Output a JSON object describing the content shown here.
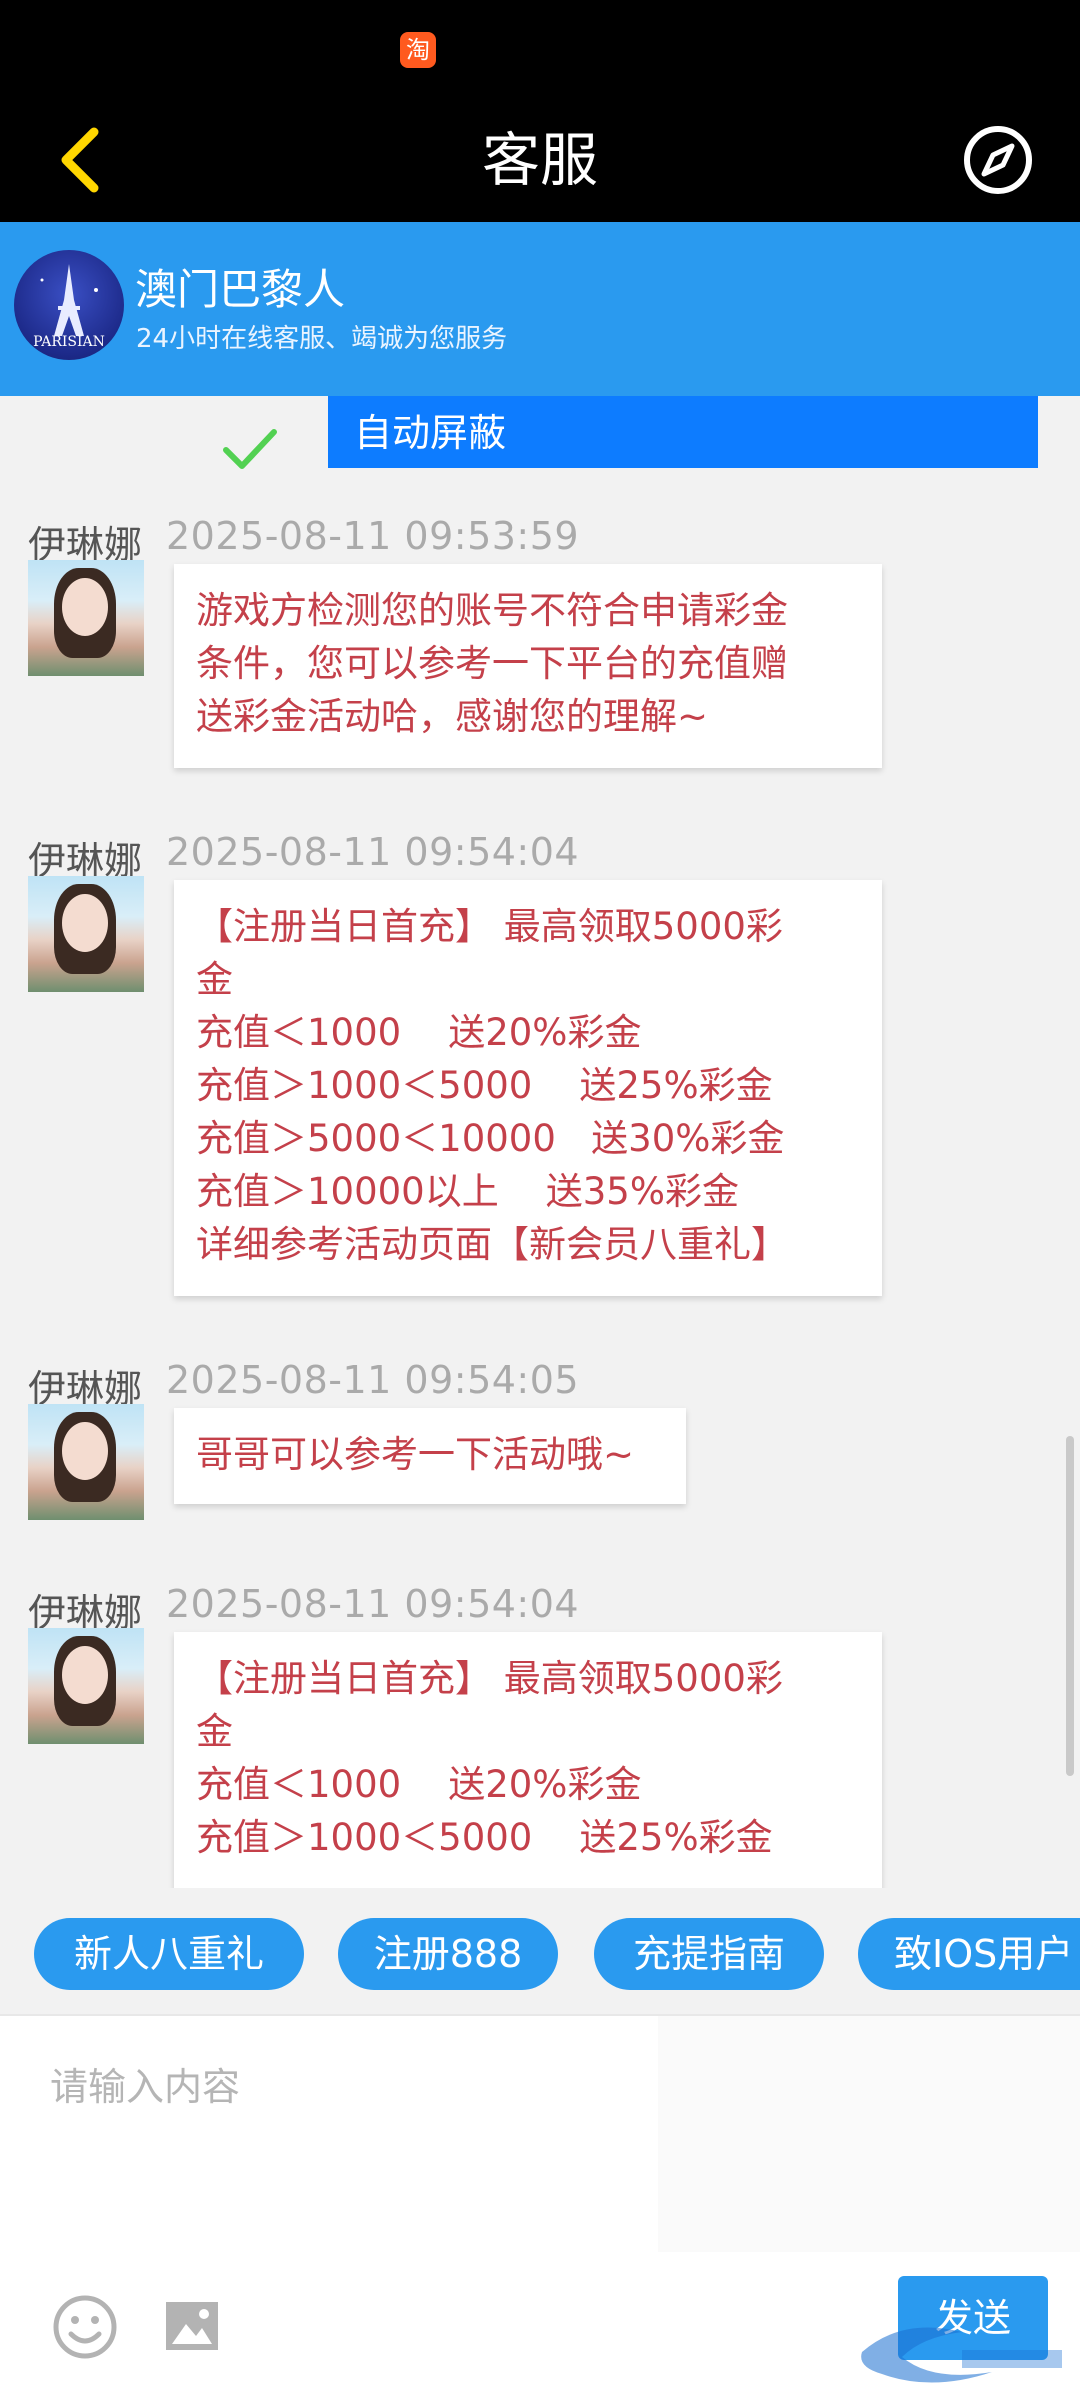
{
  "status_bar": {
    "app_icon_label": "淘"
  },
  "nav": {
    "title": "客服"
  },
  "service": {
    "name": "澳门巴黎人",
    "subtitle": "24小时在线客服、竭诚为您服务",
    "logo_text": "PARISIAN"
  },
  "chat": {
    "top_bubble_text": "自动屏蔽",
    "messages": [
      {
        "sender": "伊琳娜",
        "time": "2025-08-11 09:53:59",
        "text": "游戏方检测您的账号不符合申请彩金\n条件，您可以参考一下平台的充值赠\n送彩金活动哈，感谢您的理解~"
      },
      {
        "sender": "伊琳娜",
        "time": "2025-08-11 09:54:04",
        "text": "【注册当日首充】 最高领取5000彩\n金\n充值＜1000    送20%彩金\n充值＞1000＜5000    送25%彩金\n充值＞5000＜10000   送30%彩金\n充值＞10000以上    送35%彩金\n详细参考活动页面【新会员八重礼】"
      },
      {
        "sender": "伊琳娜",
        "time": "2025-08-11 09:54:05",
        "text": "哥哥可以参考一下活动哦~"
      },
      {
        "sender": "伊琳娜",
        "time": "2025-08-11 09:54:04",
        "text": "【注册当日首充】 最高领取5000彩\n金\n充值＜1000    送20%彩金\n充值＞1000＜5000    送25%彩金"
      }
    ]
  },
  "quick_replies": [
    "新人八重礼",
    "注册888",
    "充提指南",
    "致IOS用户"
  ],
  "composer": {
    "placeholder": "请输入内容",
    "send_label": "发送"
  },
  "colors": {
    "header_blue": "#2a9aef",
    "bubble_text": "#c4404a",
    "top_bubble": "#0d7cff",
    "check_green": "#52d152"
  }
}
